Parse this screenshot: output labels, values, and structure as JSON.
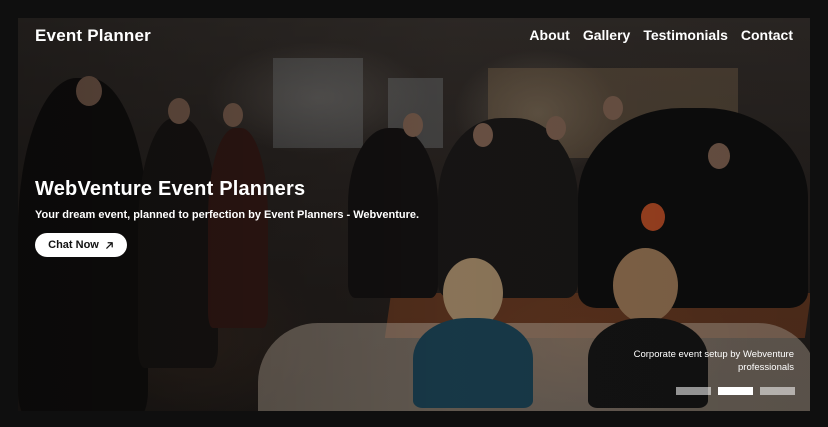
{
  "header": {
    "brand": "Event Planner",
    "nav": [
      "About",
      "Gallery",
      "Testimonials",
      "Contact"
    ]
  },
  "hero": {
    "title": "WebVenture Event Planners",
    "subtitle": "Your dream event, planned to perfection by Event Planners - Webventure.",
    "cta_label": "Chat Now",
    "cta_icon": "arrow-up-right-icon"
  },
  "slide": {
    "caption": "Corporate event setup by Webventure professionals",
    "indicators": 3,
    "active_index": 1
  },
  "colors": {
    "text": "#ffffff",
    "cta_bg": "#ffffff",
    "page_bg": "#0f0f0f"
  }
}
